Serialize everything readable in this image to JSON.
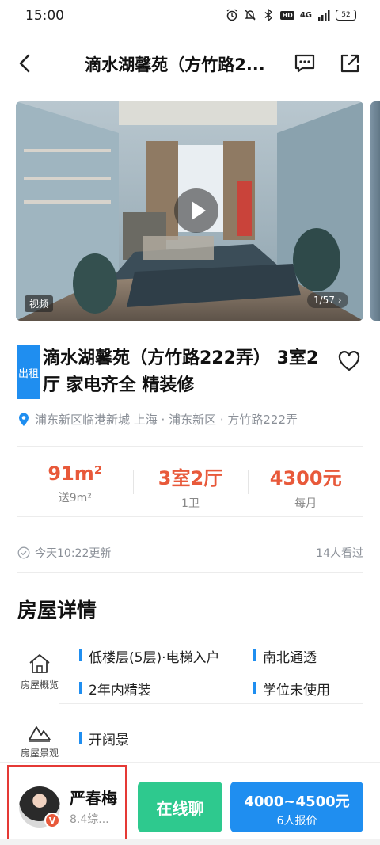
{
  "status_bar": {
    "time": "15:00",
    "network": "4G",
    "hd": "HD",
    "battery": "52",
    "icons": [
      "alarm-icon",
      "mute-icon",
      "bluetooth-icon",
      "hd-icon",
      "signal-icon",
      "battery-icon"
    ]
  },
  "navbar": {
    "title": "滴水湖馨苑（方竹路2...",
    "icons": [
      "back-arrow-icon",
      "message-icon",
      "share-icon"
    ]
  },
  "media": {
    "video_tag": "视频",
    "photo_count": "1/57 ›"
  },
  "listing": {
    "badge": "出租",
    "title": "滴水湖馨苑（方竹路222弄） 3室2厅 家电齐全 精装修",
    "location": "浦东新区临港新城 上海 · 浦东新区 · 方竹路222弄"
  },
  "stats": [
    {
      "value": "91m²",
      "sub": "送9m²"
    },
    {
      "value": "3室2厅",
      "sub": "1卫"
    },
    {
      "value": "4300元",
      "sub": "每月"
    }
  ],
  "update": {
    "updated": "今天10:22更新",
    "views": "14人看过"
  },
  "details": {
    "section_title": "房屋详情",
    "overview_label": "房屋概览",
    "overview_features": [
      "低楼层(5层)·电梯入户",
      "南北通透",
      "2年内精装",
      "学位未使用"
    ],
    "view_label": "房屋景观",
    "view_features": [
      "开阔景"
    ]
  },
  "bottom": {
    "agent_name": "严春梅",
    "agent_score": "8.4综...",
    "verified": "V",
    "chat_button": "在线聊",
    "quote_main": "4000~4500元",
    "quote_sub": "6人报价"
  },
  "colors": {
    "accent_blue": "#1f8ef0",
    "price_orange": "#e8593a",
    "chat_green": "#2ec98e",
    "highlight_red": "#e53935"
  }
}
